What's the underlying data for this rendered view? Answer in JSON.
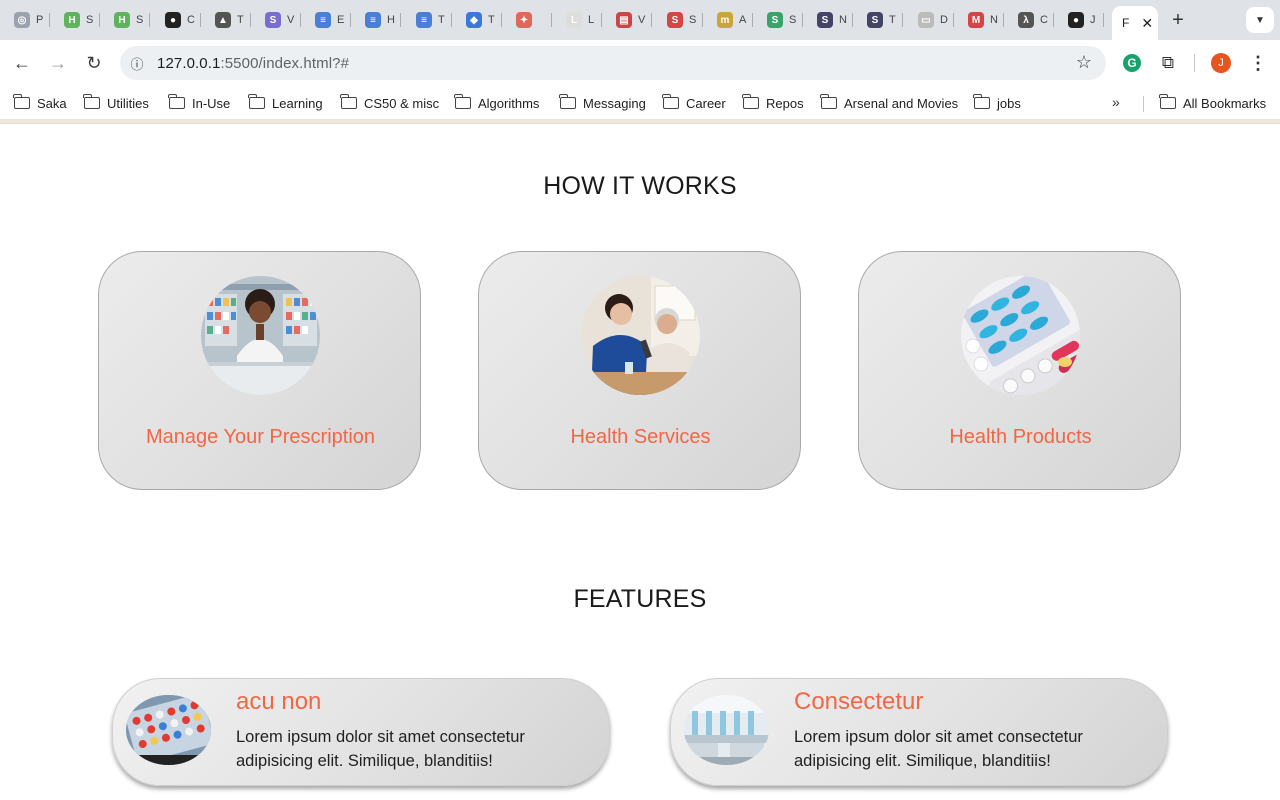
{
  "browser": {
    "tabs": [
      {
        "letter": "P",
        "color": "#9aa3ad",
        "glyph": "◎"
      },
      {
        "letter": "S",
        "color": "#5fb35f",
        "glyph": "H"
      },
      {
        "letter": "S",
        "color": "#5fb35f",
        "glyph": "H"
      },
      {
        "letter": "C",
        "color": "#222222",
        "glyph": "●"
      },
      {
        "letter": "T",
        "color": "#555555",
        "glyph": "▲"
      },
      {
        "letter": "V",
        "color": "#7b6cd0",
        "glyph": "S"
      },
      {
        "letter": "E",
        "color": "#4a7fd6",
        "glyph": "≡"
      },
      {
        "letter": "H",
        "color": "#4a7fd6",
        "glyph": "≡"
      },
      {
        "letter": "T",
        "color": "#4a7fd6",
        "glyph": "≡"
      },
      {
        "letter": "T",
        "color": "#3c78d8",
        "glyph": "◆"
      },
      {
        "letter": "",
        "color": "#e0685a",
        "glyph": "✦"
      },
      {
        "letter": "L",
        "color": "#dddddd",
        "glyph": "L"
      },
      {
        "letter": "V",
        "color": "#c44",
        "glyph": "▤"
      },
      {
        "letter": "S",
        "color": "#d64545",
        "glyph": "S"
      },
      {
        "letter": "A",
        "color": "#c9a53c",
        "glyph": "m"
      },
      {
        "letter": "S",
        "color": "#3aa36a",
        "glyph": "S"
      },
      {
        "letter": "N",
        "color": "#444466",
        "glyph": "S"
      },
      {
        "letter": "T",
        "color": "#444466",
        "glyph": "S"
      },
      {
        "letter": "D",
        "color": "#bbbbbb",
        "glyph": "▭"
      },
      {
        "letter": "N",
        "color": "#d64545",
        "glyph": "M"
      },
      {
        "letter": "C",
        "color": "#555",
        "glyph": "λ"
      },
      {
        "letter": "J",
        "color": "#222222",
        "glyph": "●"
      }
    ],
    "active_tab_letter": "F",
    "url_host": "127.0.0.1",
    "url_rest": ":5500/index.html?#",
    "profile_initial": "J",
    "bookmarks": [
      "Saka",
      "Utilities",
      "In-Use",
      "Learning",
      "CS50 & misc",
      "Algorithms",
      "Messaging",
      "Career",
      "Repos",
      "Arsenal and Movies",
      "jobs"
    ],
    "all_bookmarks": "All Bookmarks"
  },
  "how_it_works": {
    "title": "HOW IT WORKS",
    "cards": [
      {
        "label": "Manage Your Prescription"
      },
      {
        "label": "Health Services"
      },
      {
        "label": "Health Products"
      }
    ]
  },
  "features": {
    "title": "FEATURES",
    "cards": [
      {
        "title": "acu non",
        "text": "Lorem ipsum dolor sit amet consectetur adipisicing elit. Similique, blanditiis!"
      },
      {
        "title": "Consectetur",
        "text": "Lorem ipsum dolor sit amet consectetur adipisicing elit. Similique, blanditiis!"
      }
    ]
  },
  "colors": {
    "accent": "#f26646",
    "card_border": "#a9a9a9"
  }
}
